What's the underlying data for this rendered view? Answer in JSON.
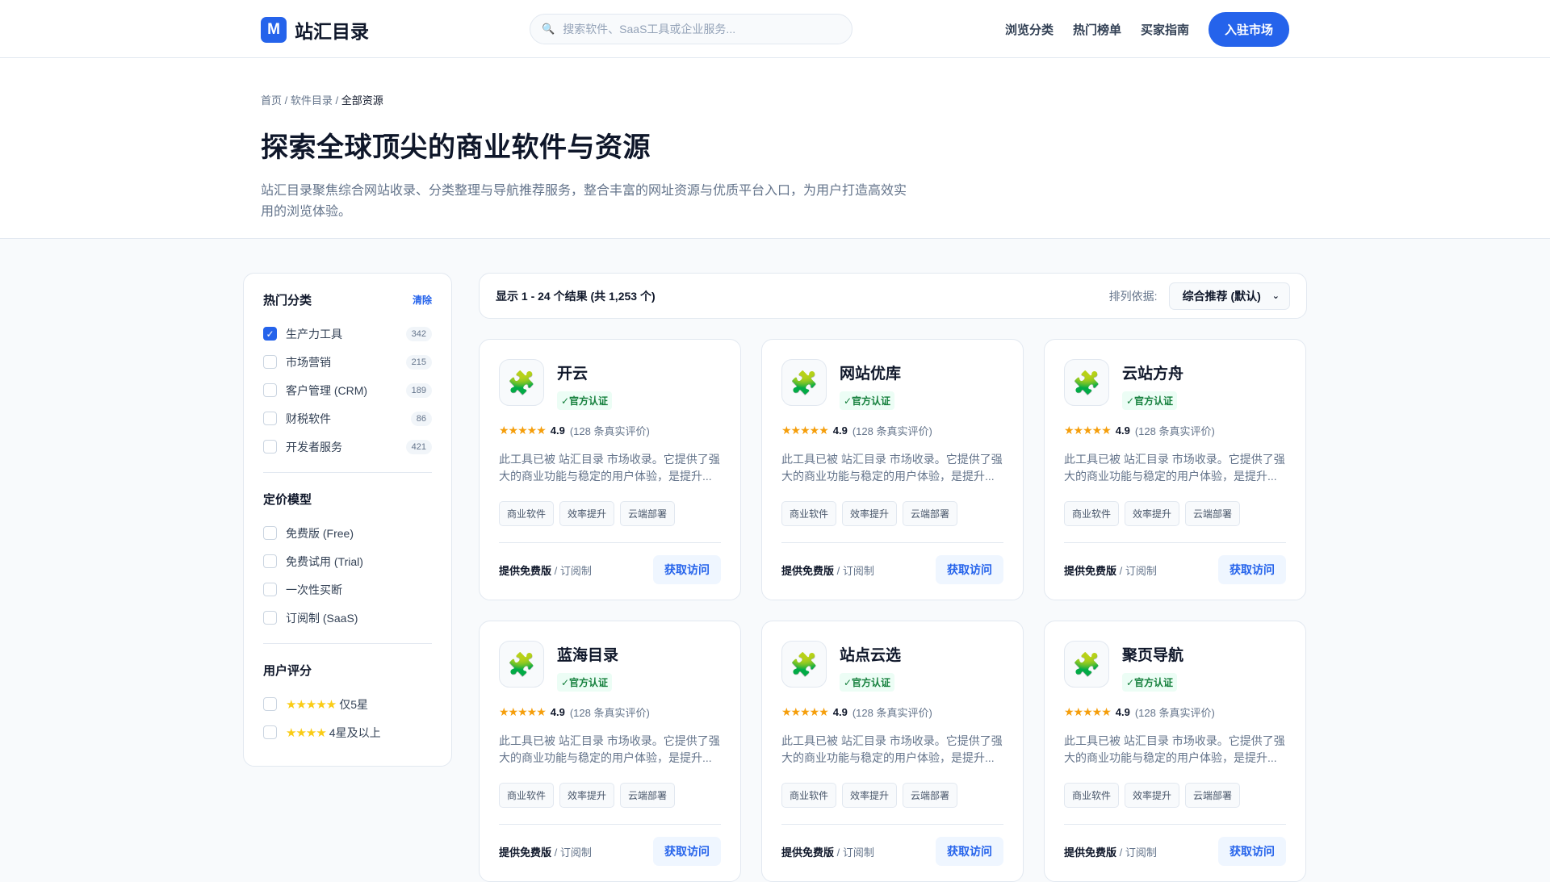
{
  "header": {
    "logo_letter": "M",
    "site_name": "站汇目录",
    "search_placeholder": "搜索软件、SaaS工具或企业服务...",
    "nav": [
      "浏览分类",
      "热门榜单",
      "买家指南"
    ],
    "cta": "入驻市场"
  },
  "hero": {
    "breadcrumb": [
      "首页",
      "软件目录",
      "全部资源"
    ],
    "title": "探索全球顶尖的商业软件与资源",
    "description": "站汇目录聚焦综合网站收录、分类整理与导航推荐服务，整合丰富的网址资源与优质平台入口，为用户打造高效实用的浏览体验。"
  },
  "sidebar": {
    "categories": {
      "title": "热门分类",
      "clear": "清除",
      "items": [
        {
          "label": "生产力工具",
          "count": "342",
          "checked": true
        },
        {
          "label": "市场营销",
          "count": "215"
        },
        {
          "label": "客户管理 (CRM)",
          "count": "189"
        },
        {
          "label": "财税软件",
          "count": "86"
        },
        {
          "label": "开发者服务",
          "count": "421"
        }
      ]
    },
    "pricing": {
      "title": "定价模型",
      "items": [
        "免费版 (Free)",
        "免费试用 (Trial)",
        "一次性买断",
        "订阅制 (SaaS)"
      ]
    },
    "rating": {
      "title": "用户评分",
      "items": [
        {
          "stars": "★★★★★",
          "label": "仅5星"
        },
        {
          "stars": "★★★★",
          "label": "4星及以上"
        }
      ]
    }
  },
  "results": {
    "summary": "显示 1 - 24 个结果 (共 1,253 个)",
    "sort_label": "排列依据:",
    "sort_value": "综合推荐 (默认)"
  },
  "cards": [
    {
      "name": "开云",
      "badge": "✓官方认证",
      "stars": "★★★★★",
      "score": "4.9",
      "reviews": "(128 条真实评价)",
      "desc": "此工具已被 站汇目录 市场收录。它提供了强大的商业功能与稳定的用户体验，是提升...",
      "tags": [
        "商业软件",
        "效率提升",
        "云端部署"
      ],
      "price": "提供免费版",
      "model": " / 订阅制",
      "action": "获取访问"
    },
    {
      "name": "网站优库",
      "badge": "✓官方认证",
      "stars": "★★★★★",
      "score": "4.9",
      "reviews": "(128 条真实评价)",
      "desc": "此工具已被 站汇目录 市场收录。它提供了强大的商业功能与稳定的用户体验，是提升...",
      "tags": [
        "商业软件",
        "效率提升",
        "云端部署"
      ],
      "price": "提供免费版",
      "model": " / 订阅制",
      "action": "获取访问"
    },
    {
      "name": "云站方舟",
      "badge": "✓官方认证",
      "stars": "★★★★★",
      "score": "4.9",
      "reviews": "(128 条真实评价)",
      "desc": "此工具已被 站汇目录 市场收录。它提供了强大的商业功能与稳定的用户体验，是提升...",
      "tags": [
        "商业软件",
        "效率提升",
        "云端部署"
      ],
      "price": "提供免费版",
      "model": " / 订阅制",
      "action": "获取访问"
    },
    {
      "name": "蓝海目录",
      "badge": "✓官方认证",
      "stars": "★★★★★",
      "score": "4.9",
      "reviews": "(128 条真实评价)",
      "desc": "此工具已被 站汇目录 市场收录。它提供了强大的商业功能与稳定的用户体验，是提升...",
      "tags": [
        "商业软件",
        "效率提升",
        "云端部署"
      ],
      "price": "提供免费版",
      "model": " / 订阅制",
      "action": "获取访问"
    },
    {
      "name": "站点云选",
      "badge": "✓官方认证",
      "stars": "★★★★★",
      "score": "4.9",
      "reviews": "(128 条真实评价)",
      "desc": "此工具已被 站汇目录 市场收录。它提供了强大的商业功能与稳定的用户体验，是提升...",
      "tags": [
        "商业软件",
        "效率提升",
        "云端部署"
      ],
      "price": "提供免费版",
      "model": " / 订阅制",
      "action": "获取访问"
    },
    {
      "name": "聚页导航",
      "badge": "✓官方认证",
      "stars": "★★★★★",
      "score": "4.9",
      "reviews": "(128 条真实评价)",
      "desc": "此工具已被 站汇目录 市场收录。它提供了强大的商业功能与稳定的用户体验，是提升...",
      "tags": [
        "商业软件",
        "效率提升",
        "云端部署"
      ],
      "price": "提供免费版",
      "model": " / 订阅制",
      "action": "获取访问"
    }
  ]
}
